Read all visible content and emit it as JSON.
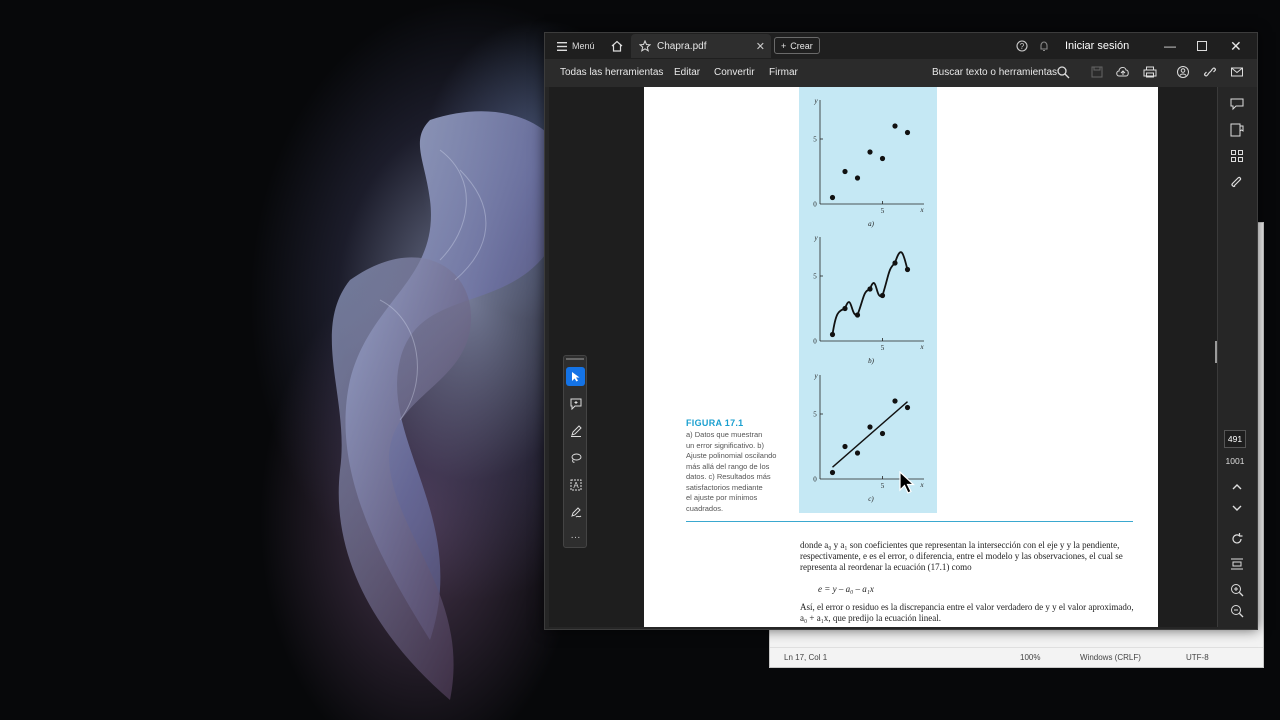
{
  "acrobat": {
    "menu_label": "Menú",
    "tab_title": "Chapra.pdf",
    "create_label": "Crear",
    "signin_label": "Iniciar sesión",
    "toolbar": {
      "all_tools": "Todas las herramientas",
      "edit": "Editar",
      "convert": "Convertir",
      "sign": "Firmar",
      "search": "Buscar texto o herramientas"
    },
    "page_number": "491",
    "page_total": "1001"
  },
  "document": {
    "figure_caption_title": "FIGURA 17.1",
    "figure_caption_lines": [
      "a) Datos que muestran",
      "un error significativo. b)",
      "Ajuste polinomial oscilando",
      "más allá del rango de los",
      "datos. c) Resultados más",
      "satisfactorios mediante",
      "el ajuste por mínimos",
      "cuadrados."
    ],
    "panel_labels": [
      "a)",
      "b)",
      "c)"
    ],
    "axis": {
      "y_label": "y",
      "x_label": "x",
      "y_tick_mid": "5",
      "x_tick_mid": "5",
      "origin": "0"
    },
    "paragraph_1": "donde a₀ y a₁ son coeficientes que representan la intersección con el eje y y la pendiente, respectivamente, e es el error, o diferencia, entre el modelo y las observaciones, el cual se representa al reordenar la ecuación (17.1) como",
    "equation": "e = y – a₀ – a₁x",
    "paragraph_2": "Así, el error o residuo es la discrepancia entre el valor verdadero de y y el valor aproximado, a₀ + a₁x, que predijo la ecuación lineal."
  },
  "notepad": {
    "position": "Ln 17, Col 1",
    "zoom": "100%",
    "line_ending": "Windows (CRLF)",
    "encoding": "UTF-8"
  },
  "chart_data": [
    {
      "type": "scatter",
      "x": [
        1,
        2,
        3,
        4,
        5,
        6,
        7
      ],
      "y": [
        0.5,
        2.5,
        2,
        4,
        3.5,
        6,
        5.5
      ],
      "xlim": [
        0,
        8
      ],
      "ylim": [
        0,
        8
      ]
    },
    {
      "type": "line",
      "x": [
        1,
        2,
        3,
        4,
        5,
        6,
        7
      ],
      "y": [
        0.5,
        2.5,
        2,
        4,
        3.5,
        6,
        5.5
      ],
      "xlim": [
        0,
        8
      ],
      "ylim": [
        0,
        8
      ]
    },
    {
      "type": "scatter",
      "x": [
        1,
        2,
        3,
        4,
        5,
        6,
        7
      ],
      "y": [
        0.5,
        2.5,
        2,
        4,
        3.5,
        6,
        5.5
      ],
      "xlim": [
        0,
        8
      ],
      "ylim": [
        0,
        8
      ]
    }
  ],
  "colors": {
    "caption_accent": "#1a9fcf",
    "figure_bg": "#c5e8f4",
    "active_tool": "#1473e6"
  }
}
